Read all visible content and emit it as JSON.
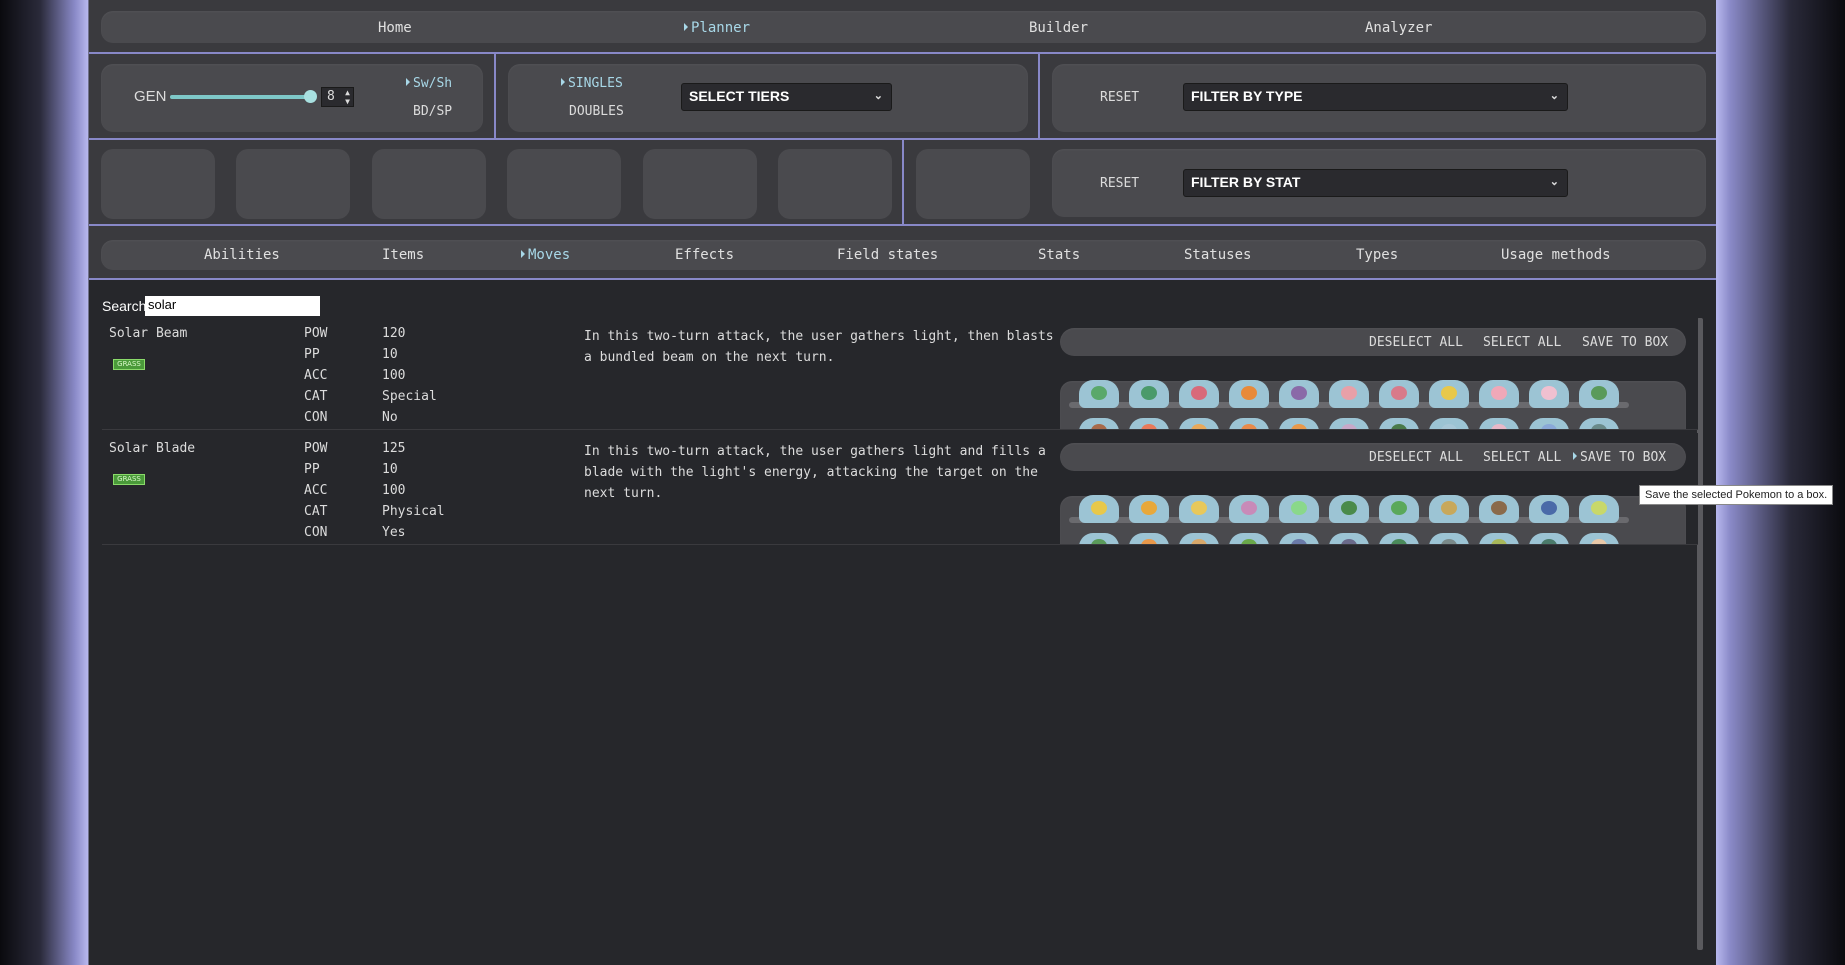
{
  "nav": {
    "items": [
      "Home",
      "Planner",
      "Builder",
      "Analyzer"
    ],
    "active": "Planner"
  },
  "gen": {
    "label": "GEN",
    "value": "8",
    "games": [
      "Sw/Sh",
      "BD/SP"
    ],
    "active_game": "Sw/Sh",
    "slider_level": 1.0
  },
  "format": {
    "options": [
      "SINGLES",
      "DOUBLES"
    ],
    "active": "SINGLES",
    "tiers_select": "SELECT TIERS"
  },
  "type_filter": {
    "reset": "RESET",
    "select": "FILTER BY TYPE"
  },
  "stat_filter": {
    "reset": "RESET",
    "select": "FILTER BY STAT"
  },
  "categories": {
    "items": [
      "Abilities",
      "Items",
      "Moves",
      "Effects",
      "Field states",
      "Stats",
      "Statuses",
      "Types",
      "Usage methods"
    ],
    "active": "Moves"
  },
  "search": {
    "label": "Search",
    "value": "solar"
  },
  "moves": [
    {
      "name": "Solar Beam",
      "type": "GRASS",
      "stats": [
        [
          "POW",
          "120"
        ],
        [
          "PP",
          "10"
        ],
        [
          "ACC",
          "100"
        ],
        [
          "CAT",
          "Special"
        ],
        [
          "CON",
          "No"
        ]
      ],
      "description": "In this two-turn attack, the user gathers light, then blasts a bundled beam on the next turn.",
      "actions": [
        "DESELECT ALL",
        "SELECT ALL",
        "SAVE TO BOX"
      ]
    },
    {
      "name": "Solar Blade",
      "type": "GRASS",
      "stats": [
        [
          "POW",
          "125"
        ],
        [
          "PP",
          "10"
        ],
        [
          "ACC",
          "100"
        ],
        [
          "CAT",
          "Physical"
        ],
        [
          "CON",
          "Yes"
        ]
      ],
      "description": "In this two-turn attack, the user gathers light and fills a blade with the light's energy, attacking the target on the next turn.",
      "actions": [
        "DESELECT ALL",
        "SELECT ALL",
        "SAVE TO BOX"
      ]
    }
  ],
  "tooltip": "Save the selected Pokemon to a box.",
  "colors": {
    "accent": "#8888c8",
    "active_text": "#a8d8e8",
    "grass": "#4a9a3a",
    "sprite_bg": "#9cc4d4"
  }
}
